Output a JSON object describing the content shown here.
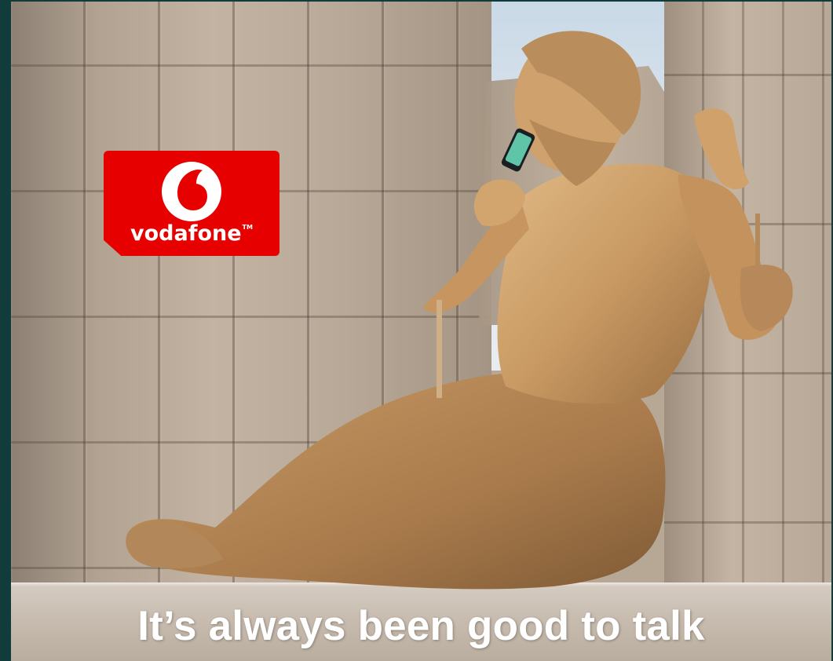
{
  "brand": {
    "name": "vodafone",
    "trademark": "TM",
    "color": "#e60000"
  },
  "tagline": "It’s always been good to talk",
  "colors": {
    "frame": "#113c3b",
    "stone": "#b7a896",
    "statue": "#c79a63"
  }
}
